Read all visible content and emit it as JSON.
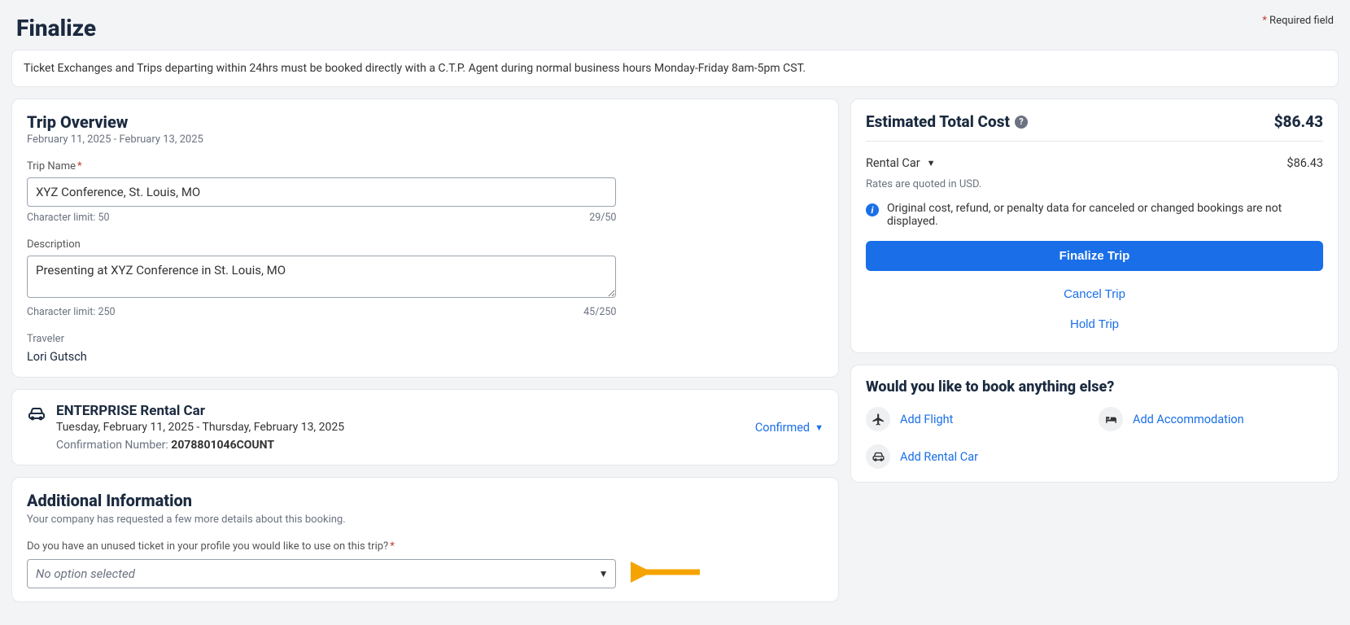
{
  "header": {
    "title": "Finalize",
    "required_note_prefix": "*",
    "required_note_text": " Required field"
  },
  "notice": "Ticket Exchanges and Trips departing within 24hrs must be booked directly with a C.T.P. Agent during normal business hours Monday-Friday 8am-5pm CST.",
  "overview": {
    "title": "Trip Overview",
    "date_range": "February 11, 2025 - February 13, 2025",
    "trip_name_label": "Trip Name",
    "trip_name_value": "XYZ Conference, St. Louis, MO",
    "trip_name_limit_label": "Character limit: 50",
    "trip_name_count": "29/50",
    "description_label": "Description",
    "description_value": "Presenting at XYZ Conference in St. Louis, MO",
    "description_limit_label": "Character limit: 250",
    "description_count": "45/250",
    "traveler_label": "Traveler",
    "traveler_name": "Lori Gutsch"
  },
  "rental": {
    "title": "ENTERPRISE Rental Car",
    "dates": "Tuesday, February 11, 2025 - Thursday, February 13, 2025",
    "confirmation_label": "Confirmation Number: ",
    "confirmation_number": "2078801046COUNT",
    "status": "Confirmed"
  },
  "additional": {
    "title": "Additional Information",
    "subtitle": "Your company has requested a few more details about this booking.",
    "question": "Do you have an unused ticket in your profile you would like to use on this trip?",
    "placeholder": "No option selected"
  },
  "cost": {
    "title": "Estimated Total Cost",
    "total": "$86.43",
    "line_item_label": "Rental Car",
    "line_item_value": "$86.43",
    "quote_note": "Rates are quoted in USD.",
    "info_text": "Original cost, refund, or penalty data for canceled or changed bookings are not displayed.",
    "finalize_btn": "Finalize Trip",
    "cancel_btn": "Cancel Trip",
    "hold_btn": "Hold Trip"
  },
  "book_more": {
    "title": "Would you like to book anything else?",
    "flight": "Add Flight",
    "accommodation": "Add Accommodation",
    "rental": "Add Rental Car"
  }
}
